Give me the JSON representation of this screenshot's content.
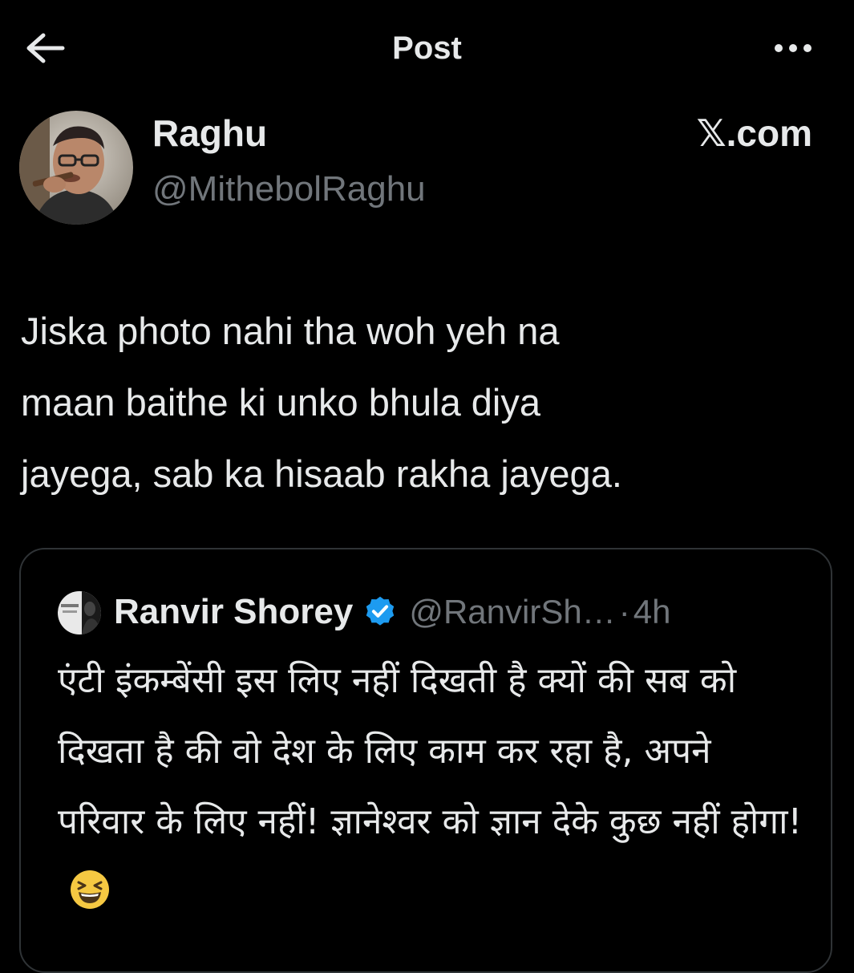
{
  "header": {
    "title": "Post",
    "back_icon": "arrow-left-icon",
    "more_icon": "more-horizontal-icon"
  },
  "author": {
    "name": "Raghu",
    "handle": "@MithebolRaghu"
  },
  "watermark": "𝕏.com",
  "post": {
    "text": "Jiska photo nahi tha woh yeh na\nmaan baithe ki unko bhula diya\njayega, sab ka hisaab rakha jayega."
  },
  "quote": {
    "name": "Ranvir Shorey",
    "verified_icon": "verified-badge-icon",
    "handle": "@RanvirSh…",
    "separator": "·",
    "time": "4h",
    "text": "एंटी इंकम्बेंसी इस लिए नहीं दिखती है क्यों की सब को दिखता है की वो देश के लिए काम कर रहा है, अपने परिवार के लिए नहीं! ज्ञानेश्वर को ज्ञान देके कुछ नहीं होगा!",
    "emoji": "grinning-squinting-face-emoji"
  },
  "colors": {
    "background": "#000000",
    "text_primary": "#e7e9ea",
    "text_secondary": "#71767b",
    "border": "#2f3336",
    "verified": "#1d9bf0"
  }
}
